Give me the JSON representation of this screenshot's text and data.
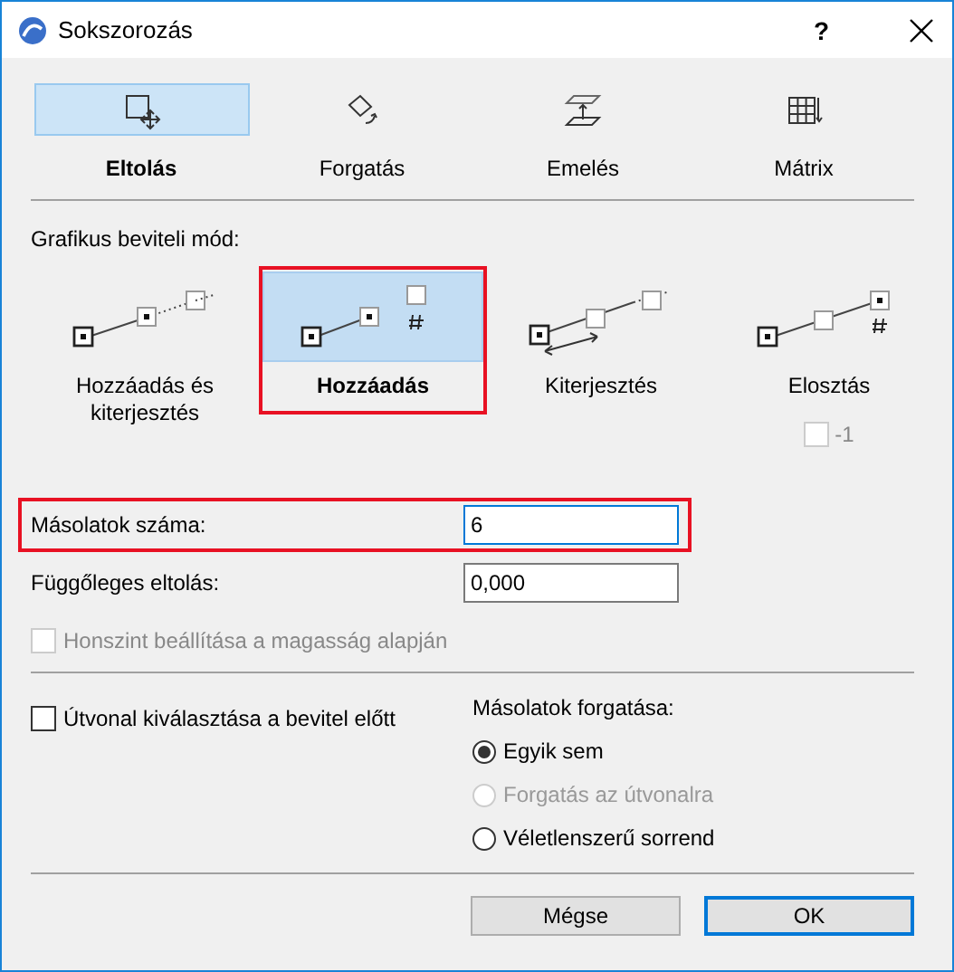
{
  "window": {
    "title": "Sokszorozás",
    "help": "?"
  },
  "tabs": [
    {
      "label": "Eltolás",
      "kind": "move",
      "selected": true
    },
    {
      "label": "Forgatás",
      "kind": "rotate",
      "selected": false
    },
    {
      "label": "Emelés",
      "kind": "elevate",
      "selected": false
    },
    {
      "label": "Mátrix",
      "kind": "matrix",
      "selected": false
    }
  ],
  "input_mode": {
    "label": "Grafikus beviteli mód:",
    "options": [
      {
        "label": "Hozzáadás és kiterjesztés",
        "kind": "add-extend",
        "selected": false,
        "highlighted": false
      },
      {
        "label": "Hozzáadás",
        "kind": "add",
        "selected": true,
        "highlighted": true
      },
      {
        "label": "Kiterjesztés",
        "kind": "extend",
        "selected": false,
        "highlighted": false
      },
      {
        "label": "Elosztás",
        "kind": "distribute",
        "selected": false,
        "highlighted": false
      }
    ],
    "distribute_checkbox": {
      "label": "-1",
      "checked": false,
      "disabled": true
    }
  },
  "fields": [
    {
      "label": "Másolatok száma:",
      "value": "6",
      "focused": true,
      "highlighted": true
    },
    {
      "label": "Függőleges eltolás:",
      "value": "0,000",
      "focused": false,
      "highlighted": false
    }
  ],
  "level_checkbox": {
    "label": "Honszint beállítása a magasság alapján",
    "checked": false,
    "disabled": true
  },
  "path_checkbox": {
    "label": "Útvonal kiválasztása a bevitel előtt",
    "checked": false,
    "disabled": false
  },
  "rotation": {
    "label": "Másolatok forgatása:",
    "options": [
      {
        "label": "Egyik sem",
        "selected": true,
        "disabled": false
      },
      {
        "label": "Forgatás az útvonalra",
        "selected": false,
        "disabled": true
      },
      {
        "label": "Véletlenszerű sorrend",
        "selected": false,
        "disabled": false
      }
    ]
  },
  "buttons": [
    {
      "label": "Mégse",
      "default": false
    },
    {
      "label": "OK",
      "default": true
    }
  ]
}
